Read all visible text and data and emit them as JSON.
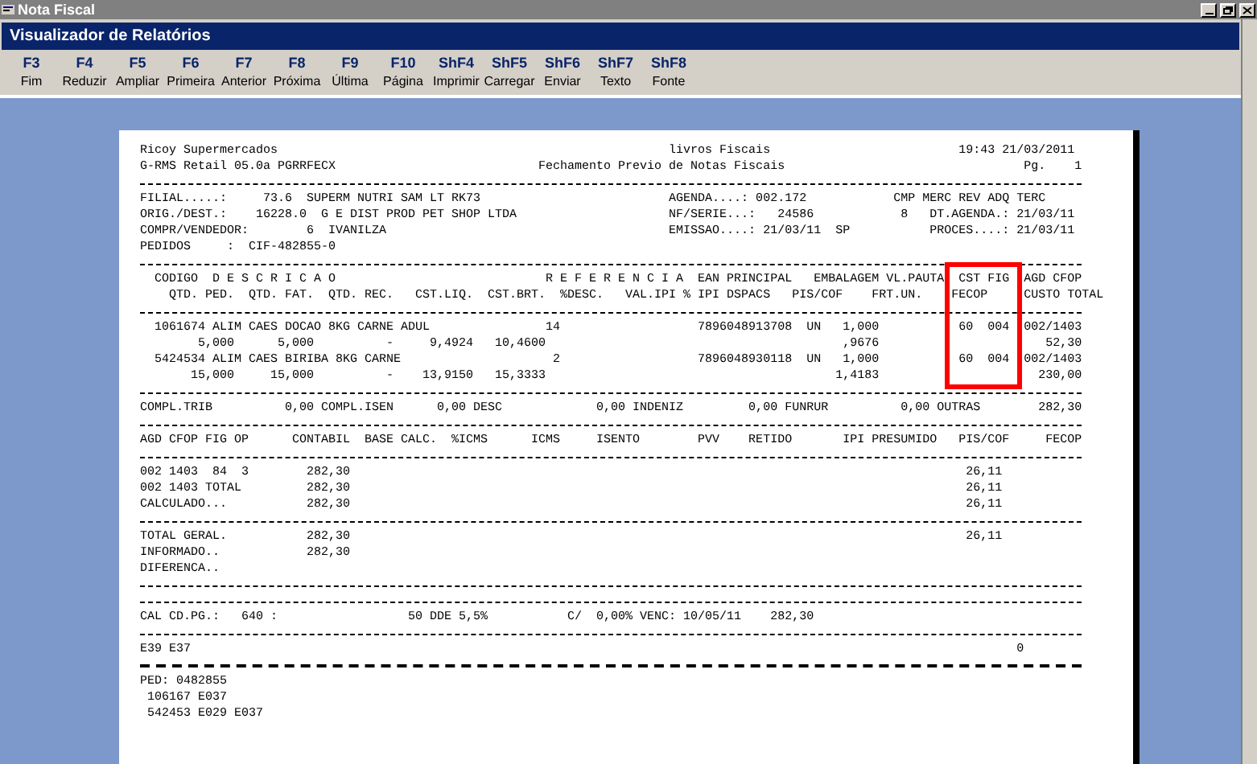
{
  "window": {
    "title": "Nota Fiscal"
  },
  "viewer": {
    "title": "Visualizador de Relatórios"
  },
  "toolbar": [
    {
      "key": "F3",
      "label": "Fim"
    },
    {
      "key": "F4",
      "label": "Reduzir"
    },
    {
      "key": "F5",
      "label": "Ampliar"
    },
    {
      "key": "F6",
      "label": "Primeira"
    },
    {
      "key": "F7",
      "label": "Anterior"
    },
    {
      "key": "F8",
      "label": "Próxima"
    },
    {
      "key": "F9",
      "label": "Última"
    },
    {
      "key": "F10",
      "label": "Página"
    },
    {
      "key": "ShF4",
      "label": "Imprimir"
    },
    {
      "key": "ShF5",
      "label": "Carregar"
    },
    {
      "key": "ShF6",
      "label": "Enviar"
    },
    {
      "key": "ShF7",
      "label": "Texto"
    },
    {
      "key": "ShF8",
      "label": "Fonte"
    }
  ],
  "report": {
    "highlight_frame": true,
    "lines": [
      {
        "kind": "text",
        "text": "Ricoy Supermercados                                                      livros Fiscais                          19:43 21/03/2011"
      },
      {
        "kind": "text",
        "text": "G-RMS Retail 05.0a PGRRFECX                            Fechamento Previo de Notas Fiscais                                 Pg.    1"
      },
      {
        "kind": "rule"
      },
      {
        "kind": "text",
        "text": "FILIAL.....:     73.6  SUPERM NUTRI SAM LT RK73                          AGENDA....: 002.172            CMP MERC REV ADQ TERC"
      },
      {
        "kind": "text",
        "text": "ORIG./DEST.:    16228.0  G E DIST PROD PET SHOP LTDA                     NF/SERIE...:   24586            8   DT.AGENDA.: 21/03/11"
      },
      {
        "kind": "text",
        "text": "COMPR/VENDEDOR:        6  IVANILZA                                       EMISSAO....: 21/03/11  SP           PROCES....: 21/03/11"
      },
      {
        "kind": "text",
        "text": "PEDIDOS     :  CIF-482855-0"
      },
      {
        "kind": "rule"
      },
      {
        "kind": "text",
        "text": "  CODIGO  D E S C R I C A O                             R E F E R E N C I A  EAN PRINCIPAL   EMBALAGEM VL.PAUTA  CST FIG  AGD CFOP"
      },
      {
        "kind": "text",
        "text": "    QTD. PED.  QTD. FAT.  QTD. REC.   CST.LIQ.  CST.BRT.  %DESC.   VAL.IPI % IPI DSPACS   PIS/COF    FRT.UN.    FECOP     CUSTO TOTAL"
      },
      {
        "kind": "rule"
      },
      {
        "kind": "text",
        "text": "  1061674 ALIM CAES DOCAO 8KG CARNE ADUL                14                   7896048913708  UN   1,000           60  004  002/1403"
      },
      {
        "kind": "text",
        "text": "        5,000      5,000          -     9,4924   10,4600                                         ,9676                       52,30"
      },
      {
        "kind": "text",
        "text": "  5424534 ALIM CAES BIRIBA 8KG CARNE                     2                   7896048930118  UN   1,000           60  004  002/1403"
      },
      {
        "kind": "text",
        "text": "       15,000     15,000          -    13,9150   15,3333                                        1,4183                      230,00"
      },
      {
        "kind": "rule"
      },
      {
        "kind": "text",
        "text": "COMPL.TRIB          0,00 COMPL.ISEN      0,00 DESC             0,00 INDENIZ         0,00 FUNRUR          0,00 OUTRAS        282,30"
      },
      {
        "kind": "rule"
      },
      {
        "kind": "text",
        "text": "AGD CFOP FIG OP      CONTABIL  BASE CALC.  %ICMS      ICMS     ISENTO        PVV    RETIDO       IPI PRESUMIDO   PIS/COF     FECOP"
      },
      {
        "kind": "rule"
      },
      {
        "kind": "text",
        "text": "002 1403  84  3        282,30                                                                                     26,11"
      },
      {
        "kind": "text",
        "text": "002 1403 TOTAL         282,30                                                                                     26,11"
      },
      {
        "kind": "text",
        "text": "CALCULADO...           282,30                                                                                     26,11"
      },
      {
        "kind": "rule"
      },
      {
        "kind": "text",
        "text": "TOTAL GERAL.           282,30                                                                                     26,11"
      },
      {
        "kind": "text",
        "text": "INFORMADO..            282,30"
      },
      {
        "kind": "text",
        "text": "DIFERENCA.."
      },
      {
        "kind": "rule"
      },
      {
        "kind": "rule"
      },
      {
        "kind": "text",
        "text": "CAL CD.PG.:   640 :                  50 DDE 5,5%           C/  0,00% VENC: 10/05/11    282,30"
      },
      {
        "kind": "rule"
      },
      {
        "kind": "text",
        "text": "E39 E37                                                                                                                  0"
      },
      {
        "kind": "heavy_rule"
      },
      {
        "kind": "text",
        "text": "PED: 0482855"
      },
      {
        "kind": "text",
        "text": " 106167 E037"
      },
      {
        "kind": "text",
        "text": " 542453 E029 E037"
      }
    ]
  }
}
